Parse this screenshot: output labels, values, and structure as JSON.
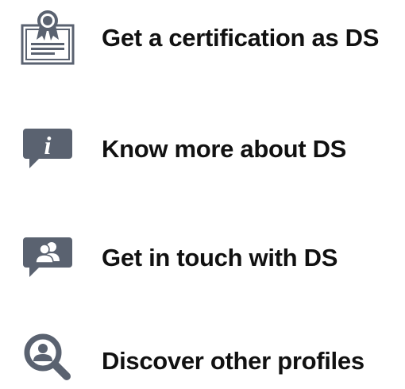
{
  "colors": {
    "icon": "#5a6270",
    "icon_light": "#ffffff",
    "text": "#111111"
  },
  "menu": {
    "items": [
      {
        "label": "Get a certification as DS",
        "icon": "certificate-icon"
      },
      {
        "label": "Know more about DS",
        "icon": "info-chat-icon"
      },
      {
        "label": "Get in touch with DS",
        "icon": "contacts-chat-icon"
      },
      {
        "label": "Discover other profiles",
        "icon": "profile-search-icon"
      }
    ]
  }
}
